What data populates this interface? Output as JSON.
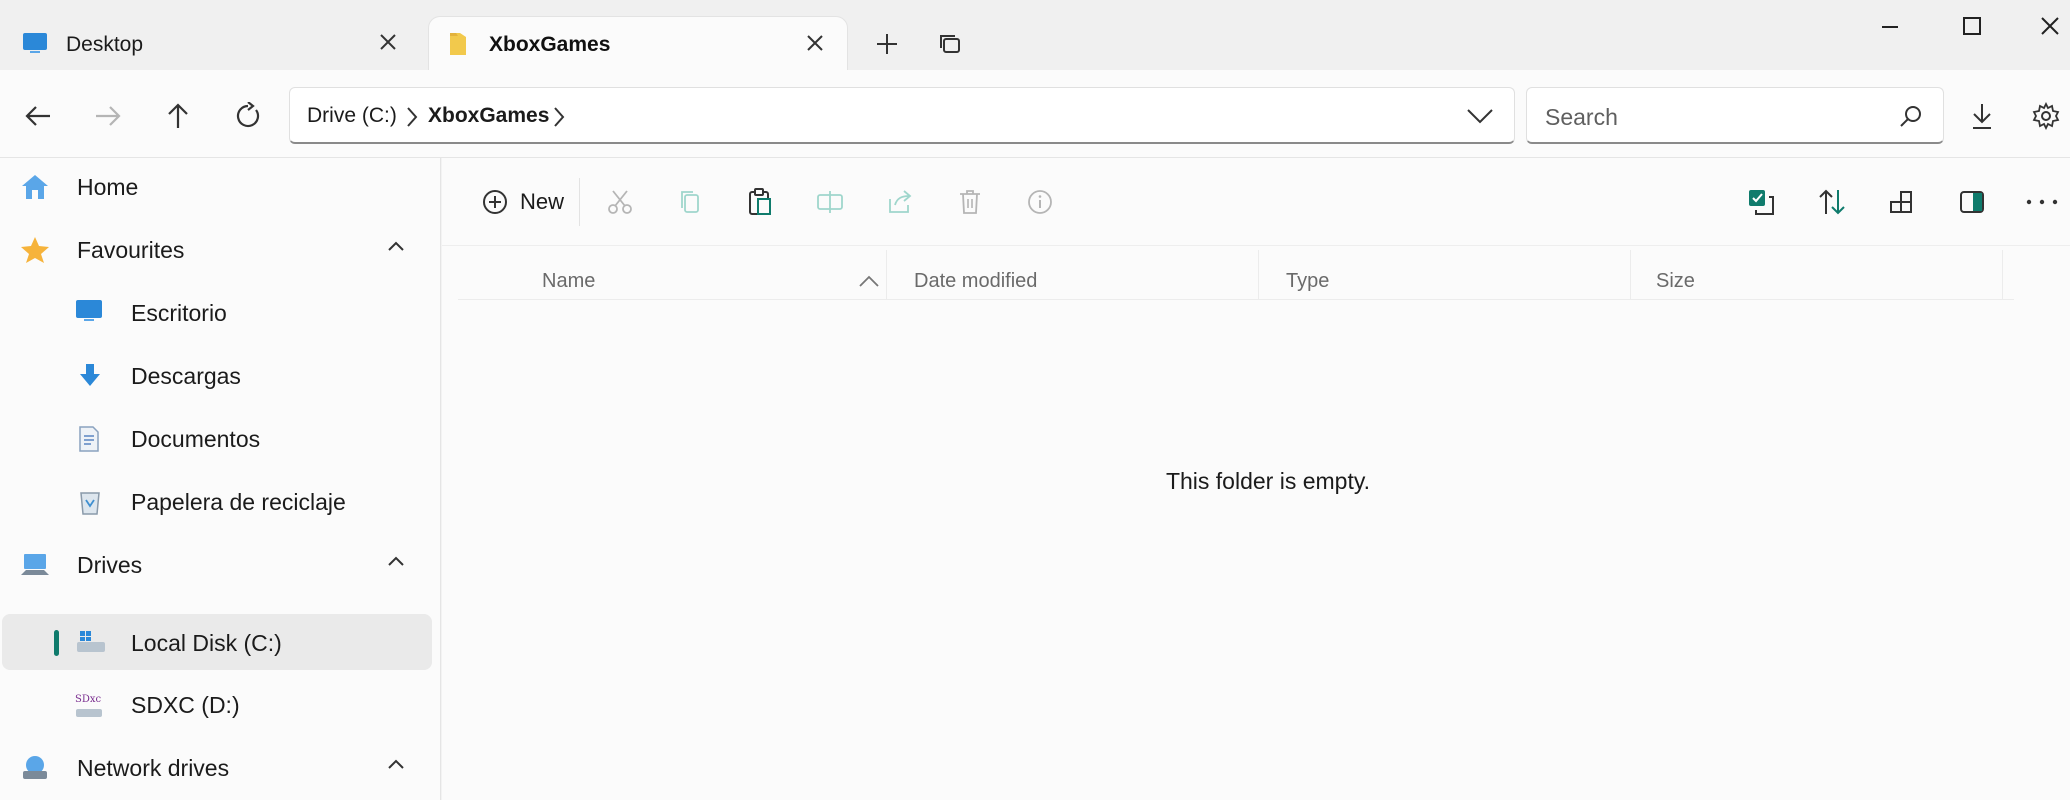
{
  "tabs": [
    {
      "label": "Desktop",
      "icon": "desktop-icon",
      "active": false
    },
    {
      "label": "XboxGames",
      "icon": "folder-icon",
      "active": true
    }
  ],
  "window_controls": {
    "minimize": "minimize-icon",
    "maximize": "maximize-icon",
    "close": "close-icon"
  },
  "address": {
    "crumbs": [
      "Drive (C:)",
      "XboxGames"
    ]
  },
  "search": {
    "placeholder": "Search"
  },
  "sidebar": {
    "home": "Home",
    "favourites": {
      "label": "Favourites",
      "items": [
        "Escritorio",
        "Descargas",
        "Documentos",
        "Papelera de reciclaje"
      ]
    },
    "drives": {
      "label": "Drives",
      "items": [
        "Local Disk (C:)",
        "SDXC (D:)"
      ]
    },
    "network": "Network drives"
  },
  "toolbar": {
    "new_label": "New"
  },
  "columns": [
    "Name",
    "Date modified",
    "Type",
    "Size"
  ],
  "empty_message": "This folder is empty.",
  "colors": {
    "accent": "#0f7b6c",
    "folder": "#f2c94c",
    "star": "#f6b33b",
    "blue": "#2b88d8"
  }
}
